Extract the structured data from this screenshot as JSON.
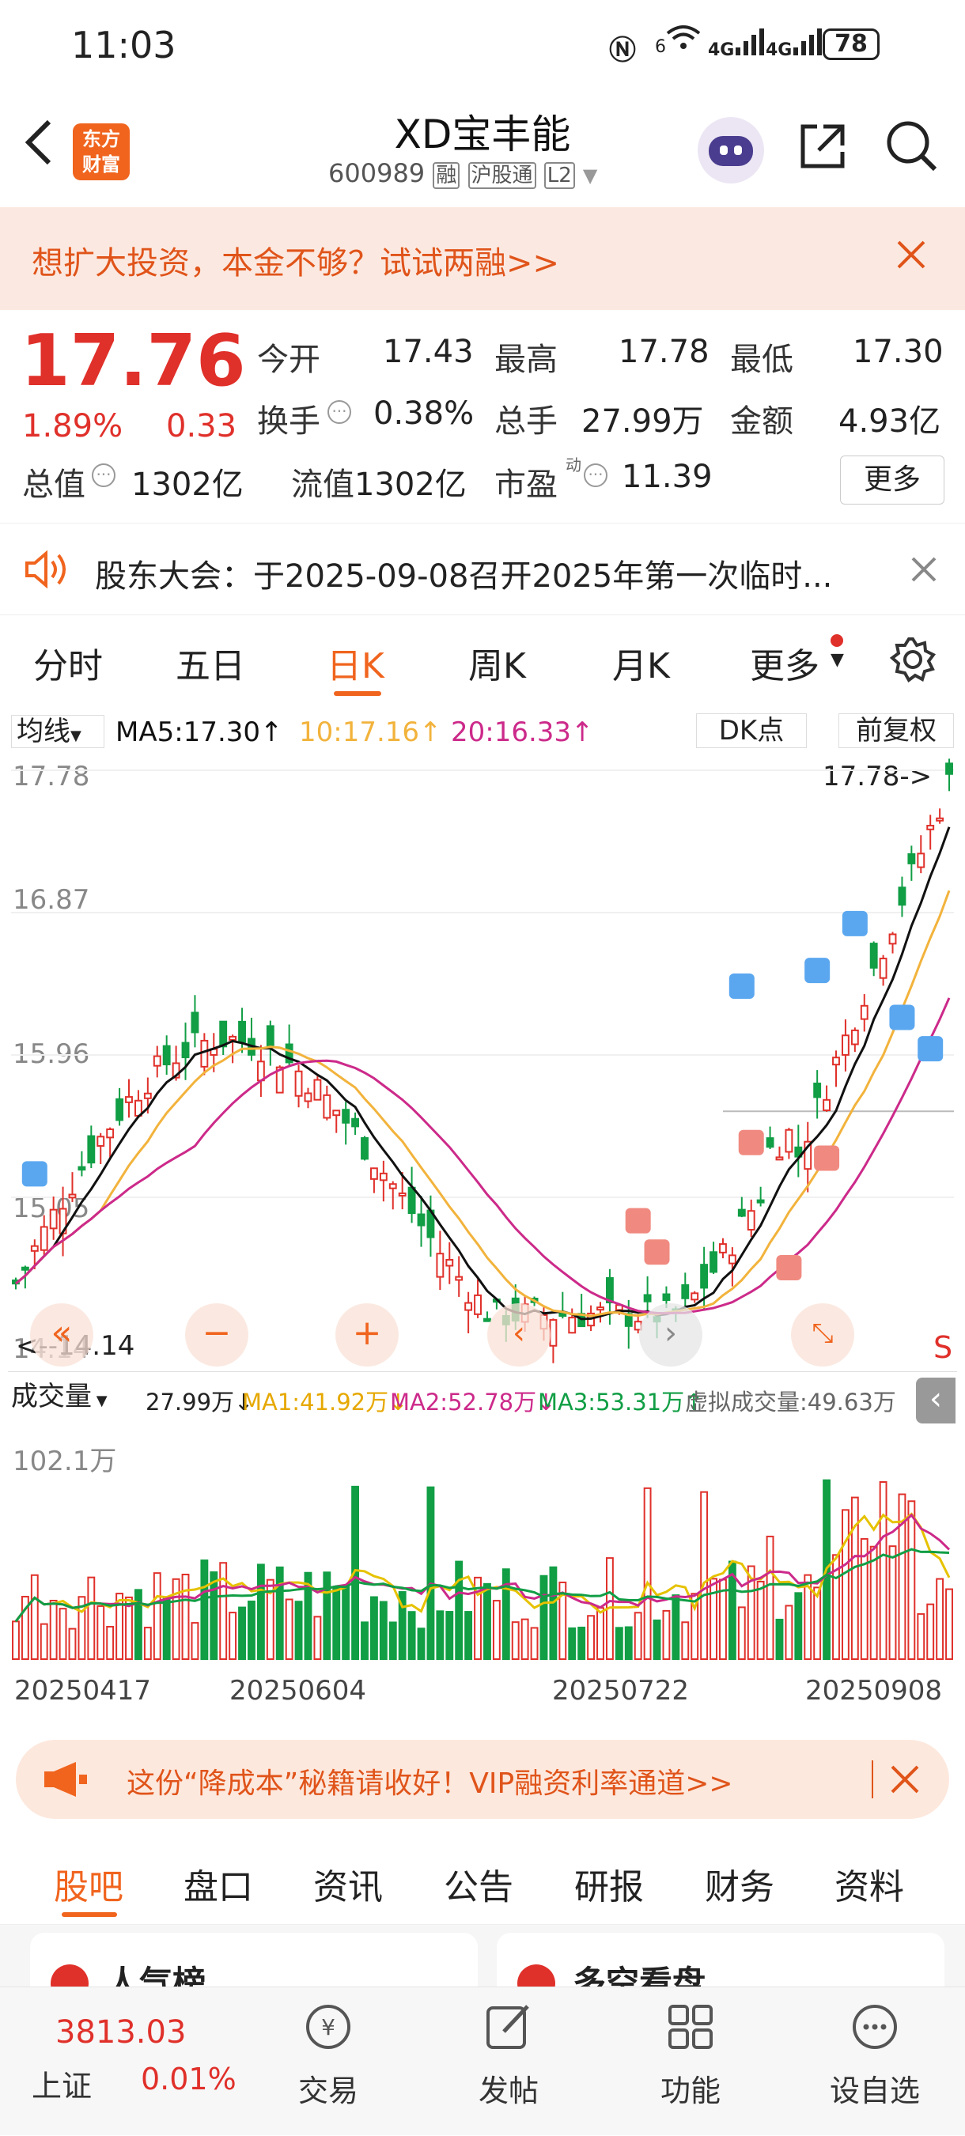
{
  "status": {
    "time": "11:03",
    "net1": "6",
    "net2": "4G",
    "net3": "4G",
    "battery": "78"
  },
  "header": {
    "logo_line1": "东方",
    "logo_line2": "财富",
    "title": "XD宝丰能",
    "code": "600989",
    "tag1": "融",
    "tag2": "沪股通",
    "tag3": "L2"
  },
  "promo": {
    "text": "想扩大投资，本金不够？试试两融>>"
  },
  "quote": {
    "price": "17.76",
    "pct": "1.89%",
    "chg": "0.33",
    "open_label": "今开",
    "open": "17.43",
    "high_label": "最高",
    "high": "17.78",
    "low_label": "最低",
    "low": "17.30",
    "turnover_label": "换手",
    "turnover": "0.38%",
    "volume_label": "总手",
    "volume": "27.99万",
    "amount_label": "金额",
    "amount": "4.93亿",
    "mcap_label": "总值",
    "mcap": "1302亿",
    "float_label": "流值",
    "float": "1302亿",
    "pe_label": "市盈",
    "pe_sup": "动",
    "pe": "11.39",
    "more_label": "更多"
  },
  "notice": {
    "text": "股东大会：于2025-09-08召开2025年第一次临时..."
  },
  "tabs": [
    "分时",
    "五日",
    "日K",
    "周K",
    "月K",
    "更多"
  ],
  "active_tab": "日K",
  "ma": {
    "selector": "均线",
    "ma5": "MA5:17.30↑",
    "ma10": "10:17.16↑",
    "ma20": "20:16.33↑",
    "dk": "DK点",
    "fq": "前复权"
  },
  "kline": {
    "y_ticks": [
      "17.78",
      "16.87",
      "15.96",
      "15.05",
      "14.14"
    ],
    "max_label": "17.78->",
    "min_label": "<--14.14",
    "s_label": "S"
  },
  "volume": {
    "selector": "成交量",
    "v": "27.99万↓",
    "ma1": "MA1:41.92万↓",
    "ma2": "MA2:52.78万↓",
    "ma3": "MA3:53.31万↑",
    "virtual": "虚拟成交量:49.63万",
    "max": "102.1万"
  },
  "x_dates": [
    "20250417",
    "20250604",
    "20250722",
    "20250908"
  ],
  "ad": {
    "text": "这份“降成本”秘籍请收好！VIP融资利率通道>>"
  },
  "subtabs": [
    "股吧",
    "盘口",
    "资讯",
    "公告",
    "研报",
    "财务",
    "资料"
  ],
  "cards": {
    "left": "人气榜",
    "right": "多空看盘"
  },
  "bottom": {
    "index_value": "3813.03",
    "index_name": "上证",
    "index_pct": "0.01%",
    "items": [
      "交易",
      "发帖",
      "功能",
      "设自选"
    ]
  },
  "colors": {
    "up": "#e0302a",
    "down": "#119e45",
    "accent": "#f0641e",
    "ma5": "#111111",
    "ma10": "#f2b33c",
    "ma20": "#cc2a8a"
  }
}
